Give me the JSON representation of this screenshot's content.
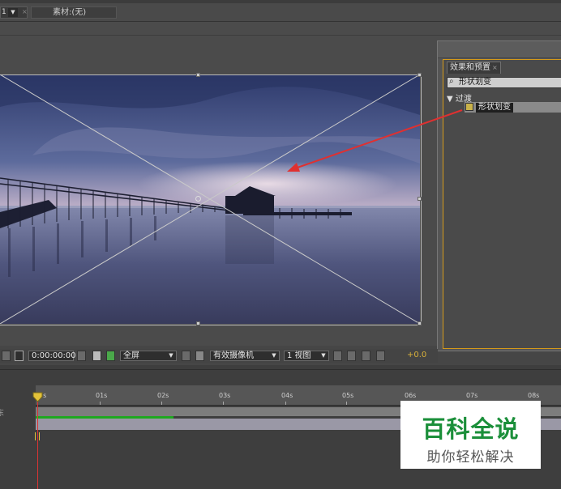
{
  "top_tabs": {
    "comp_tab_number": "1",
    "comp_tab_dropdown": "▼",
    "comp_tab_close": "×",
    "footage_tab": "素材:(无)"
  },
  "effects_panel": {
    "tab_label": "效果和预置",
    "tab_close": "×",
    "search_icon": "⌕",
    "search_value": "形状划变",
    "category": "▼ 过渡",
    "item": "形状划变"
  },
  "viewer_toolbar": {
    "timecode": "0:00:00:00",
    "resolution": "全屏",
    "camera": "有效摄像机",
    "views": "1 视图",
    "exposure": "+0.0"
  },
  "timeline": {
    "ticks": [
      "0s",
      "01s",
      "02s",
      "03s",
      "04s",
      "05s",
      "06s",
      "07s",
      "08s"
    ],
    "left_label": "东"
  },
  "watermark": {
    "title": "百科全说",
    "subtitle": "助你轻松解决"
  },
  "colors": {
    "accent_orange": "#d59a1a",
    "arrow_red": "#e03030",
    "timeline_green": "#1ea81e",
    "playhead_red": "#d83434",
    "watermark_green": "#1b8f3a"
  }
}
